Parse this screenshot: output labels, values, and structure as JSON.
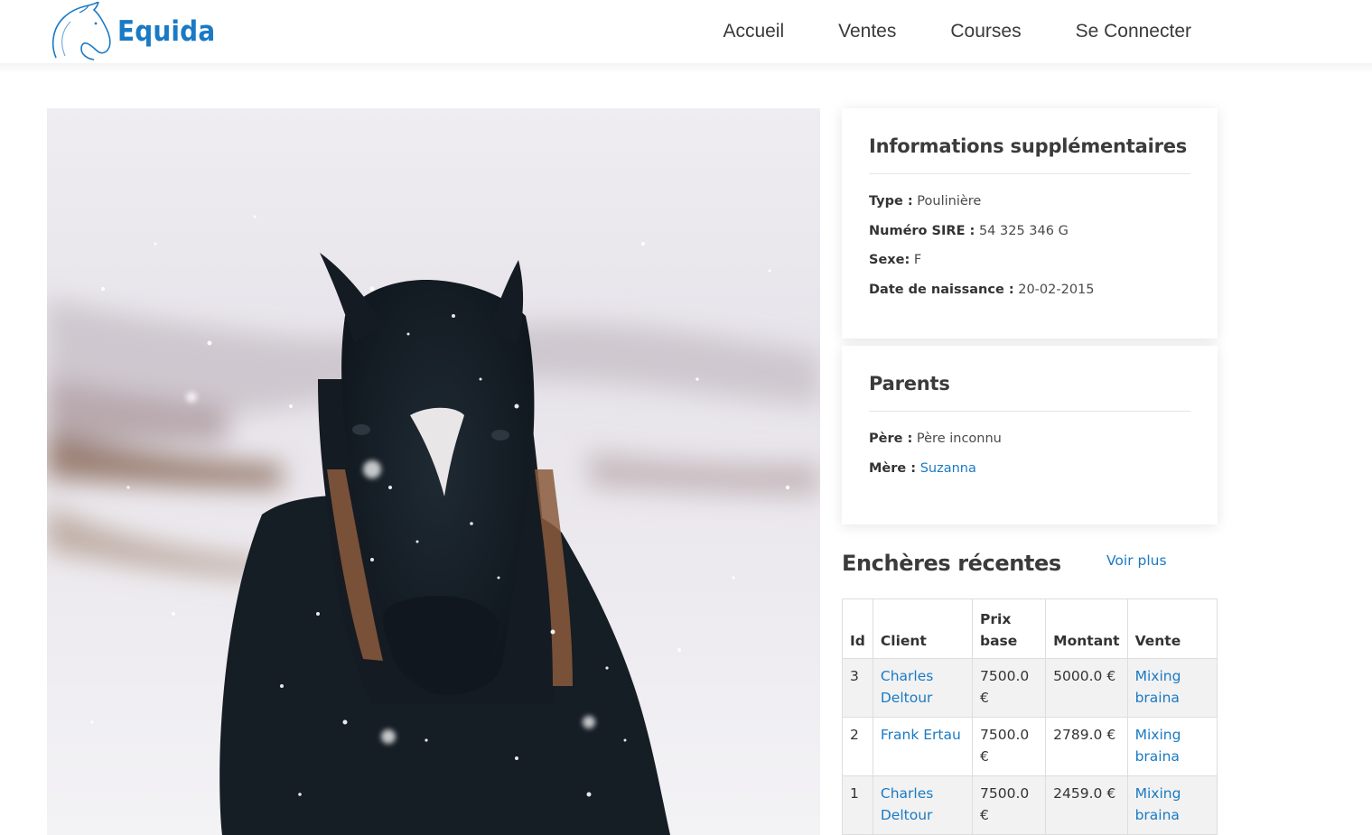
{
  "brand": {
    "name": "Equida",
    "logo_icon": "horse-head-icon",
    "accent_color": "#1a7ac4"
  },
  "nav": {
    "items": [
      {
        "label": "Accueil"
      },
      {
        "label": "Ventes"
      },
      {
        "label": "Courses"
      },
      {
        "label": "Se Connecter"
      }
    ]
  },
  "hero": {
    "subject": "horse-in-snow-photo"
  },
  "info": {
    "title": "Informations supplémentaires",
    "fields": [
      {
        "label": "Type :",
        "value": "Poulinière"
      },
      {
        "label": "Numéro SIRE :",
        "value": "54 325 346 G"
      },
      {
        "label": "Sexe:",
        "value": "F"
      },
      {
        "label": "Date de naissance :",
        "value": "20-02-2015"
      }
    ]
  },
  "parents": {
    "title": "Parents",
    "father": {
      "label": "Père :",
      "value": "Père inconnu"
    },
    "mother": {
      "label": "Mère :",
      "value": "Suzanna"
    }
  },
  "auctions": {
    "title": "Enchères récentes",
    "see_more": "Voir plus",
    "columns": [
      "Id",
      "Client",
      "Prix base",
      "Montant",
      "Vente"
    ],
    "rows": [
      {
        "id": "3",
        "client": "Charles Deltour",
        "base": "7500.0 €",
        "amount": "5000.0 €",
        "sale": "Mixing braina"
      },
      {
        "id": "2",
        "client": "Frank Ertau",
        "base": "7500.0 €",
        "amount": "2789.0 €",
        "sale": "Mixing braina"
      },
      {
        "id": "1",
        "client": "Charles Deltour",
        "base": "7500.0 €",
        "amount": "2459.0 €",
        "sale": "Mixing braina"
      }
    ]
  }
}
